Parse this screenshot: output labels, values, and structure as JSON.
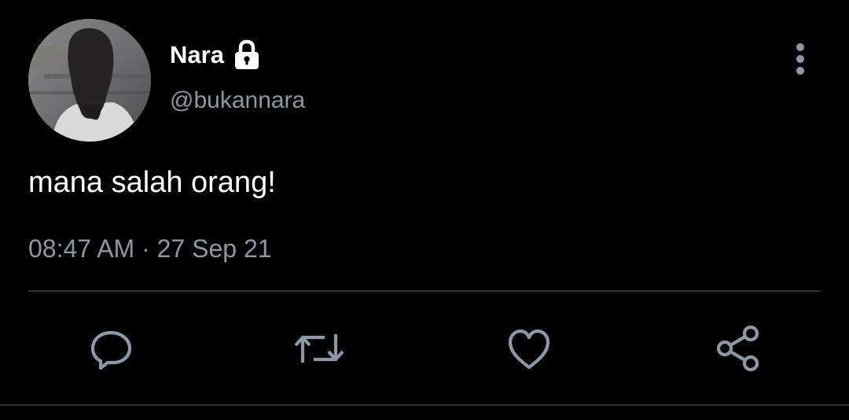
{
  "tweet": {
    "display_name": "Nara",
    "handle": "@bukannara",
    "text": "mana salah orang!",
    "time": "08:47 AM",
    "separator": "·",
    "date": "27 Sep 21"
  },
  "icons": {
    "lock": "lock-icon",
    "more": "more-vertical-icon",
    "reply": "reply-icon",
    "retweet": "retweet-icon",
    "like": "heart-icon",
    "share": "share-icon"
  },
  "colors": {
    "background": "#000000",
    "primary_text": "#ffffff",
    "secondary_text": "#8b98a5",
    "divider": "#2f3336",
    "icon": "#8b98a5"
  }
}
